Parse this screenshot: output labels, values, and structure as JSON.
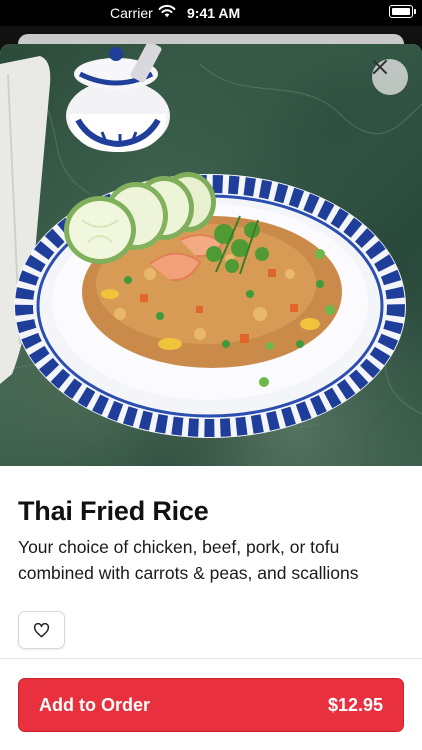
{
  "status_bar": {
    "carrier": "Carrier",
    "time": "9:41 AM"
  },
  "item": {
    "title": "Thai Fried Rice",
    "description": "Your choice of chicken, beef, pork, or tofu combined with carrots & peas, and scallions"
  },
  "actions": {
    "add_label": "Add to Order",
    "price": "$12.95"
  },
  "icons": {
    "close": "close-icon",
    "favorite": "heart-icon",
    "wifi": "wifi-icon",
    "battery": "battery-icon"
  },
  "colors": {
    "accent": "#e8303e",
    "plate_blue": "#1e3e9a",
    "marble": "#345a46"
  }
}
